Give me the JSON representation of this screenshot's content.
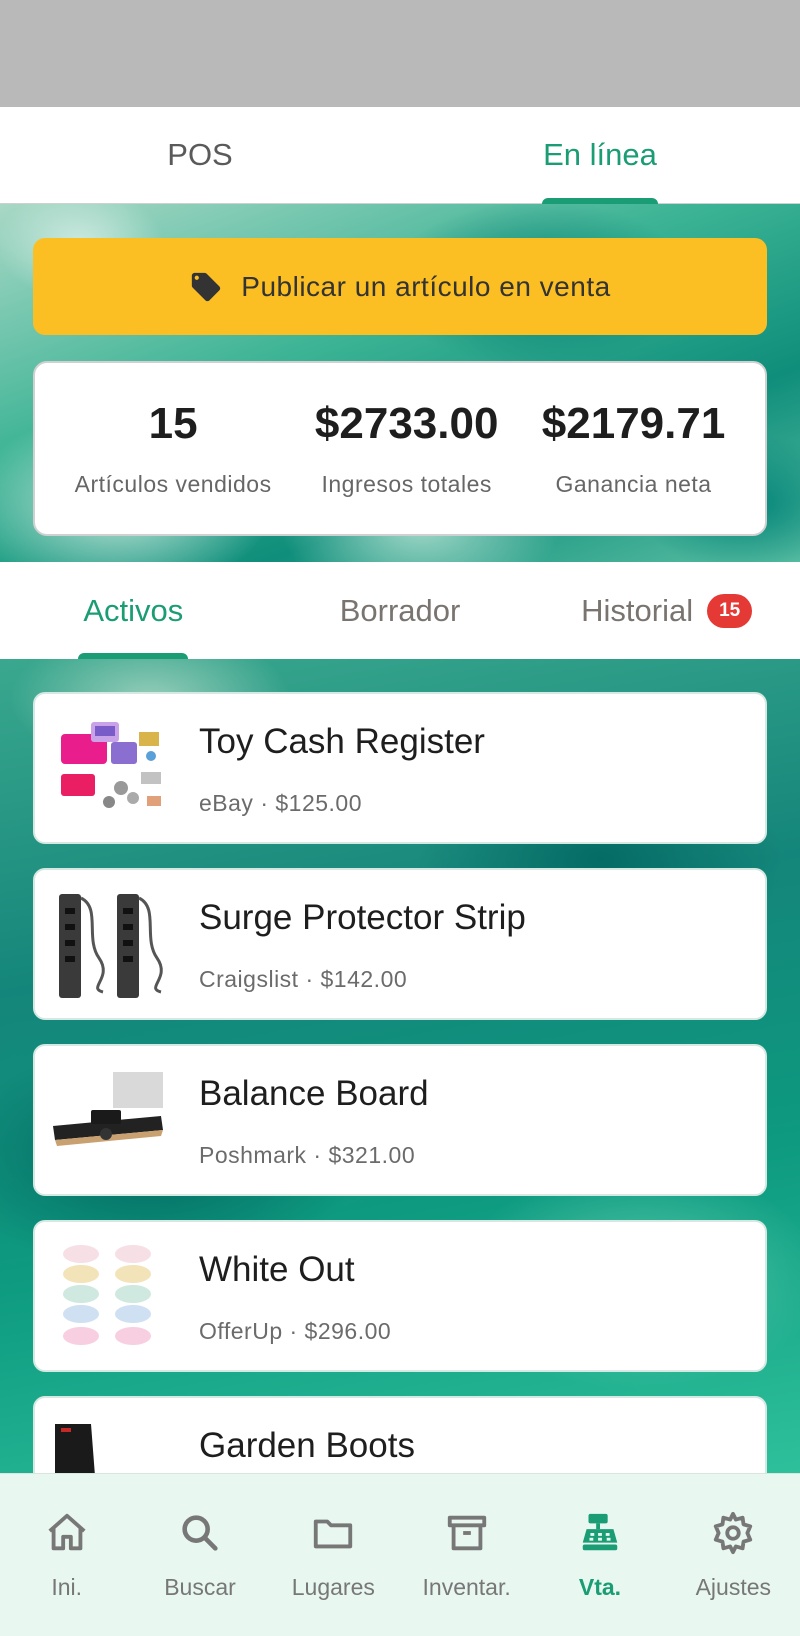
{
  "top_tabs": [
    {
      "label": "POS",
      "active": false
    },
    {
      "label": "En línea",
      "active": true
    }
  ],
  "publish_button": {
    "label": "Publicar un artículo en venta",
    "icon": "tag-icon"
  },
  "stats": [
    {
      "value": "15",
      "caption": "Artículos vendidos"
    },
    {
      "value": "$2733.00",
      "caption": "Ingresos totales"
    },
    {
      "value": "$2179.71",
      "caption": "Ganancia neta"
    }
  ],
  "sub_tabs": [
    {
      "label": "Activos",
      "active": true
    },
    {
      "label": "Borrador",
      "active": false
    },
    {
      "label": "Historial",
      "active": false,
      "badge": "15"
    }
  ],
  "listings": [
    {
      "title": "Toy Cash Register",
      "meta": "eBay · $125.00"
    },
    {
      "title": "Surge Protector Strip",
      "meta": "Craigslist · $142.00"
    },
    {
      "title": "Balance Board",
      "meta": "Poshmark · $321.00"
    },
    {
      "title": "White Out",
      "meta": "OfferUp · $296.00"
    },
    {
      "title": "Garden Boots",
      "meta": ""
    }
  ],
  "bottom_nav": [
    {
      "label": "Ini.",
      "icon": "home-icon"
    },
    {
      "label": "Buscar",
      "icon": "search-icon"
    },
    {
      "label": "Lugares",
      "icon": "folder-icon"
    },
    {
      "label": "Inventar.",
      "icon": "archive-icon"
    },
    {
      "label": "Vta.",
      "icon": "register-icon",
      "active": true
    },
    {
      "label": "Ajustes",
      "icon": "gear-icon"
    }
  ],
  "colors": {
    "accent": "#1a9c74",
    "publish": "#fbbf24",
    "badge": "#e53935",
    "nav_bg": "#e8f7ef"
  }
}
